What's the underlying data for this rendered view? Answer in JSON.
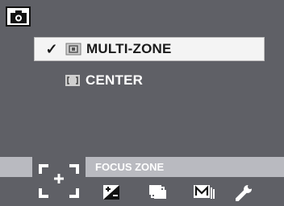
{
  "camera_mode_icon": "camera-icon",
  "menu": {
    "items": [
      {
        "check": "✓",
        "icon": "multi-zone-icon",
        "label": "MULTI-ZONE",
        "selected": true
      },
      {
        "check": "",
        "icon": "center-focus-icon",
        "label": "CENTER",
        "selected": false
      }
    ]
  },
  "focus_zone": {
    "symbol": "focus-zone-icon",
    "label": "FOCUS ZONE"
  },
  "bottom_bar": {
    "icons": [
      "exposure-compensation-icon",
      "continuous-shooting-icon",
      "manual-mode-icon",
      "setup-wrench-icon"
    ]
  },
  "colors": {
    "background": "#5f6066",
    "bar": "#b9bac0",
    "selected_item": "#f4f4f4",
    "text_light": "#ffffff"
  }
}
